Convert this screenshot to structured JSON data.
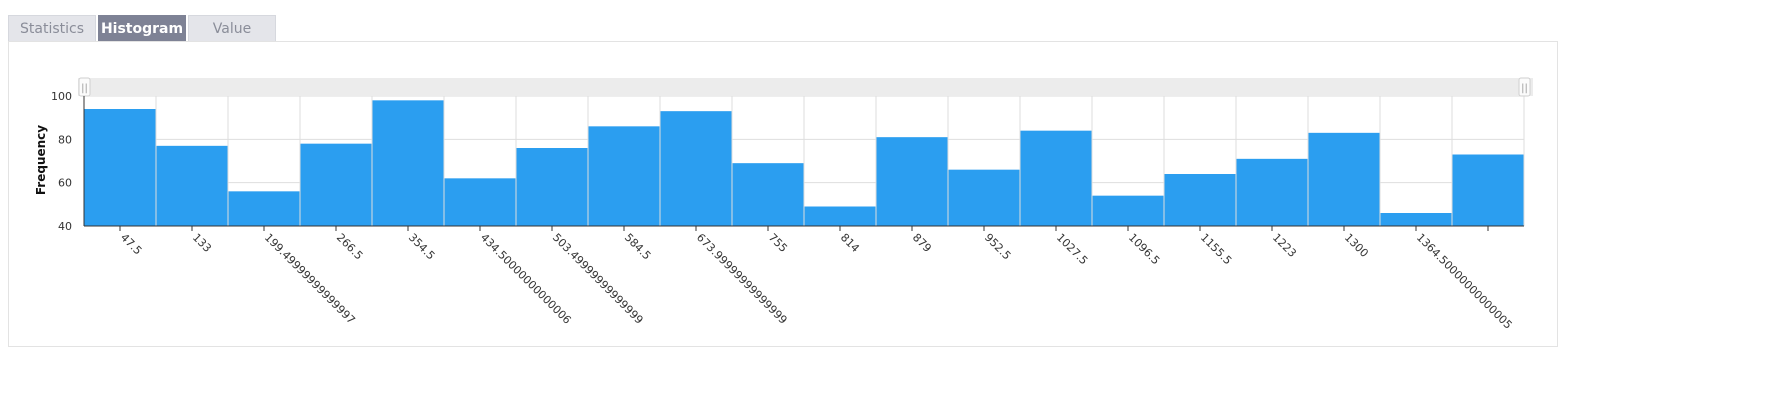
{
  "tabs": [
    {
      "label": "Statistics",
      "active": false
    },
    {
      "label": "Histogram",
      "active": true
    },
    {
      "label": "Value",
      "active": false
    }
  ],
  "chart_data": {
    "type": "bar",
    "ylabel": "Frequency",
    "ylim": [
      40,
      100
    ],
    "yticks": [
      40,
      60,
      80,
      100
    ],
    "grid": true,
    "bar_color": "#2b9ef0",
    "categories": [
      "47.5",
      "133",
      "199.49999999999997",
      "266.5",
      "354.5",
      "434.50000000000006",
      "503.49999999999999",
      "584.5",
      "673.99999999999999",
      "755",
      "814",
      "879",
      "952.5",
      "1027.5",
      "1096.5",
      "1155.5",
      "1223",
      "1300",
      "1364.50000000000005",
      ""
    ],
    "values": [
      94,
      77,
      56,
      78,
      98,
      62,
      76,
      86,
      93,
      69,
      49,
      81,
      66,
      84,
      54,
      64,
      71,
      83,
      46,
      73
    ]
  },
  "range_slider": {
    "left_handle": "||",
    "right_handle": "||"
  }
}
